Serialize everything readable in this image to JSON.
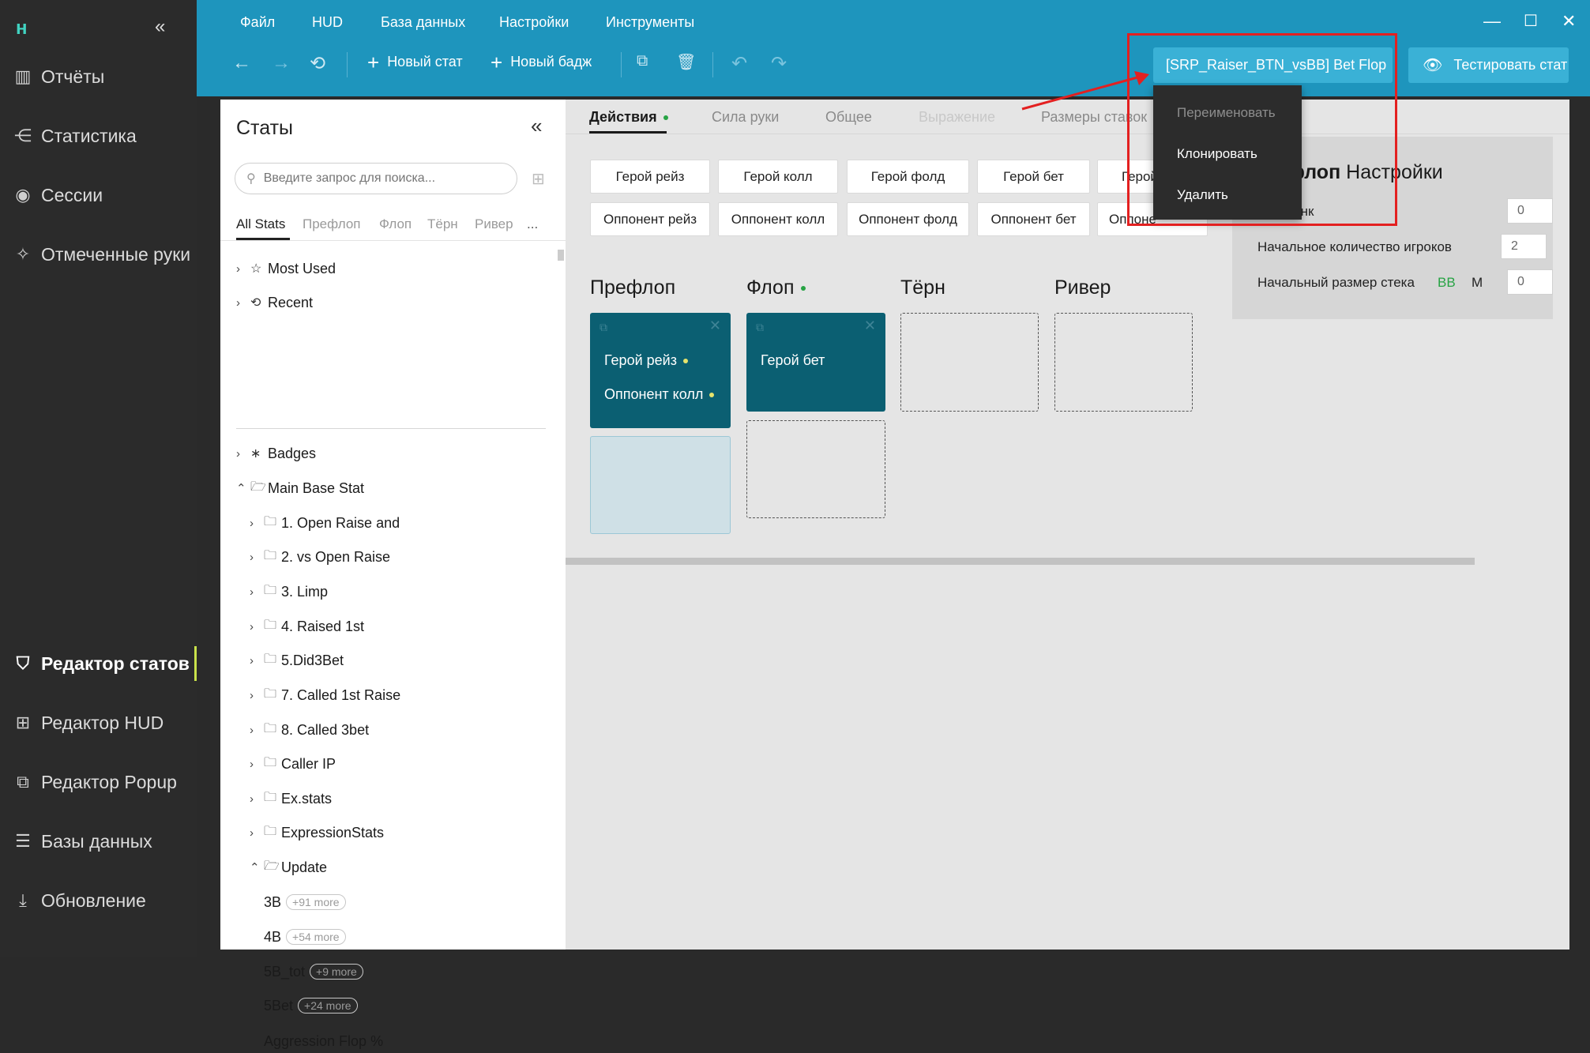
{
  "nav": {
    "collapse_icon": "chevrons-left-icon",
    "items": [
      {
        "label": "Отчёты",
        "icon": "report-icon"
      },
      {
        "label": "Статистика",
        "icon": "share-icon"
      },
      {
        "label": "Сессии",
        "icon": "broadcast-icon"
      },
      {
        "label": "Отмеченные руки",
        "icon": "sparkle-icon"
      },
      {
        "label": "Редактор статов",
        "icon": "filter-icon"
      },
      {
        "label": "Редактор HUD",
        "icon": "layout-icon"
      },
      {
        "label": "Редактор Popup",
        "icon": "copy-icon"
      },
      {
        "label": "Базы данных",
        "icon": "database-icon"
      },
      {
        "label": "Обновление",
        "icon": "download-icon"
      }
    ],
    "active_index": 4
  },
  "menu": {
    "items": [
      "Файл",
      "HUD",
      "База данных",
      "Настройки",
      "Инструменты"
    ]
  },
  "toolbar": {
    "new_stat": "Новый стат",
    "new_badge": "Новый бадж",
    "stat_selector": "[SRP_Raiser_BTN_vsBB] Bet Flop",
    "test_stat": "Тестировать стат"
  },
  "dropdown": {
    "items": [
      {
        "label": "Переименовать",
        "disabled": true
      },
      {
        "label": "Клонировать",
        "disabled": false
      },
      {
        "label": "Удалить",
        "disabled": false
      }
    ]
  },
  "stats_panel": {
    "title": "Статы",
    "search_placeholder": "Введите запрос для поиска...",
    "tabs": [
      "All Stats",
      "Префлоп",
      "Флоп",
      "Тёрн",
      "Ривер",
      "..."
    ],
    "tree": [
      {
        "label": "Most Used",
        "icon": "star-icon"
      },
      {
        "label": "Recent",
        "icon": "history-icon"
      },
      {
        "label": "Badges",
        "icon": "asterisk-icon"
      },
      {
        "label": "Main Base Stat",
        "icon": "folder-open-icon"
      },
      {
        "label": "1. Open Raise and",
        "icon": "folder-icon"
      },
      {
        "label": "2. vs Open Raise",
        "icon": "folder-icon"
      },
      {
        "label": "3. Limp",
        "icon": "folder-icon"
      },
      {
        "label": "4. Raised 1st",
        "icon": "folder-icon"
      },
      {
        "label": "5.Did3Bet",
        "icon": "folder-icon"
      },
      {
        "label": "7. Called 1st Raise",
        "icon": "folder-icon"
      },
      {
        "label": "8. Called 3bet",
        "icon": "folder-icon"
      },
      {
        "label": "Caller IP",
        "icon": "folder-icon"
      },
      {
        "label": "Ex.stats",
        "icon": "folder-icon"
      },
      {
        "label": "ExpressionStats",
        "icon": "folder-icon"
      },
      {
        "label": "Update",
        "icon": "folder-open-icon"
      }
    ],
    "leaves": [
      {
        "label": "3B",
        "more": "+91 more"
      },
      {
        "label": "4B",
        "more": "+54 more"
      },
      {
        "label": "5B_tot",
        "more": "+9 more"
      },
      {
        "label": "5Bet",
        "more": "+24 more"
      },
      {
        "label": "Aggression Flop %",
        "more": ""
      }
    ]
  },
  "editor": {
    "tabs": [
      "Действия",
      "Сила руки",
      "Общее",
      "Выражение",
      "Размеры ставок"
    ],
    "actions_row1": [
      "Герой рейз",
      "Герой колл",
      "Герой фолд",
      "Герой бет",
      "Герой"
    ],
    "actions_row2": [
      "Оппонент рейз",
      "Оппонент колл",
      "Оппонент фолд",
      "Оппонент бет",
      "Оппоне"
    ],
    "streets": [
      "Префлоп",
      "Флоп",
      "Тёрн",
      "Ривер"
    ],
    "preflop_card": [
      "Герой рейз",
      "Оппонент колл"
    ],
    "flop_card": [
      "Герой бет"
    ]
  },
  "settings": {
    "title_bold": "флоп",
    "title_rest": " Настройки",
    "rows": [
      {
        "label": "ный банк",
        "value": "0"
      },
      {
        "label": "Начальное количество игроков",
        "value": "2"
      },
      {
        "label": "Начальный размер стека",
        "value": "0"
      }
    ],
    "bb": "BB",
    "m": "M"
  },
  "colors": {
    "accent": "#1e95bd",
    "sidebar": "#2b2b2b",
    "card": "#0b5f72",
    "active_marker": "#c9e24a",
    "annotation": "#e32020"
  }
}
